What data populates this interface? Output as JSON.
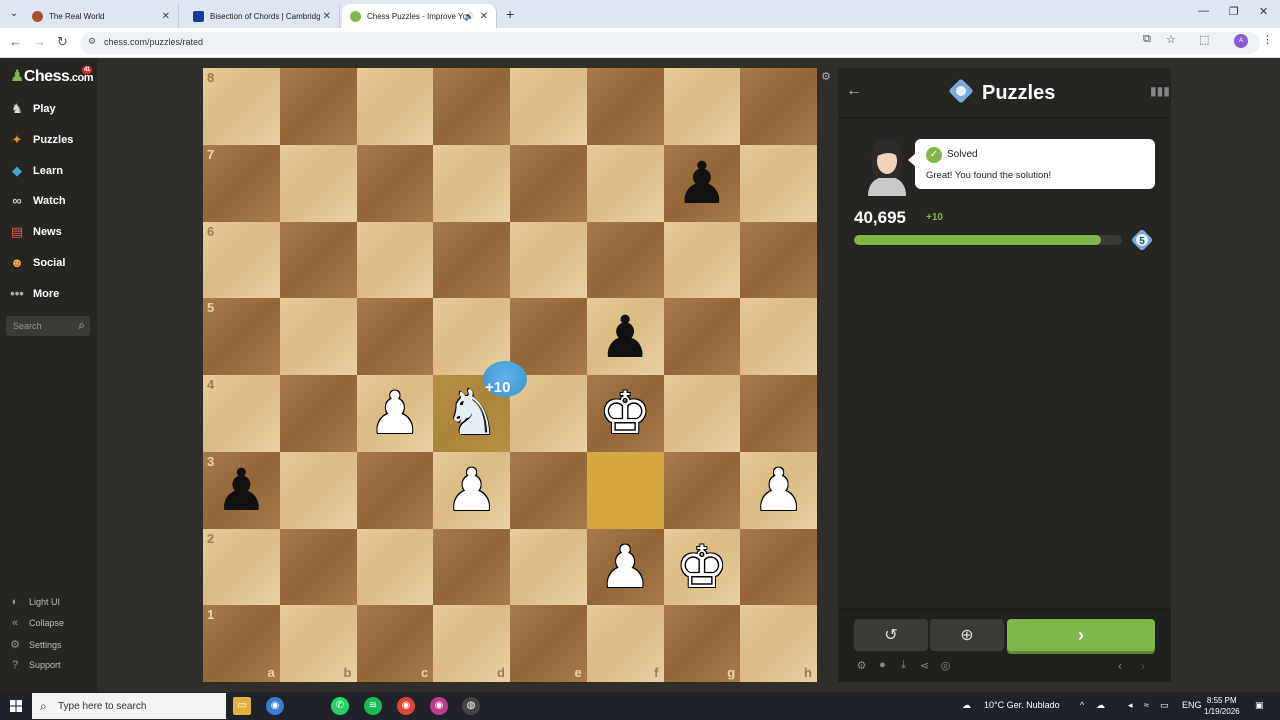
{
  "browser": {
    "tabs": [
      {
        "title": "The Real World",
        "favicon_color": "#a0522d",
        "active": false
      },
      {
        "title": "Bisection of Chords | Cambridge",
        "favicon_color": "#1a3a9c",
        "active": false
      },
      {
        "title": "Chess Puzzles - Improve Yo",
        "favicon_color": "#81b64c",
        "active": true
      }
    ],
    "url": "chess.com/puzzles/rated"
  },
  "sidebar": {
    "logo": "Chess",
    "logo_suffix": ".com",
    "notif_badge": "41",
    "items": [
      {
        "label": "Play",
        "icon": "play-board-icon"
      },
      {
        "label": "Puzzles",
        "icon": "puzzle-piece-icon"
      },
      {
        "label": "Learn",
        "icon": "learn-cap-icon"
      },
      {
        "label": "Watch",
        "icon": "binoculars-icon"
      },
      {
        "label": "News",
        "icon": "newspaper-icon"
      },
      {
        "label": "Social",
        "icon": "people-icon"
      },
      {
        "label": "More",
        "icon": "more-dots-icon"
      }
    ],
    "search_placeholder": "Search",
    "footer": [
      {
        "label": "Light UI",
        "icon": "contrast-icon"
      },
      {
        "label": "Collapse",
        "icon": "collapse-icon"
      },
      {
        "label": "Settings",
        "icon": "gear-icon"
      },
      {
        "label": "Support",
        "icon": "help-icon"
      }
    ]
  },
  "board": {
    "ranks": [
      "8",
      "7",
      "6",
      "5",
      "4",
      "3",
      "2",
      "1"
    ],
    "files": [
      "a",
      "b",
      "c",
      "d",
      "e",
      "f",
      "g",
      "h"
    ],
    "pieces": {
      "g7": {
        "glyph": "♟",
        "color": "b"
      },
      "f5": {
        "glyph": "♟",
        "color": "b"
      },
      "c4": {
        "glyph": "♟",
        "color": "w"
      },
      "d4": {
        "glyph": "♞",
        "color": "wn"
      },
      "f4": {
        "glyph": "♚",
        "color": "w"
      },
      "a3": {
        "glyph": "♟",
        "color": "b"
      },
      "d3": {
        "glyph": "♟",
        "color": "w"
      },
      "h3": {
        "glyph": "♟",
        "color": "w"
      },
      "f2": {
        "glyph": "♟",
        "color": "w"
      },
      "g2": {
        "glyph": "♚",
        "color": "w"
      }
    },
    "highlights": [
      "f3"
    ],
    "soft_highlights": [
      "d4"
    ],
    "bonus_label": "+10"
  },
  "panel": {
    "title": "Puzzles",
    "bubble_status": "Solved",
    "bubble_message": "Great! You found the solution!",
    "rating": "40,695",
    "rating_delta": "+10",
    "progress": 0.92,
    "level": "5",
    "next_label": "›"
  },
  "taskbar": {
    "search_placeholder": "Type here to search",
    "weather": "10°C  Ger. Nublado",
    "lang": "ENG",
    "time": "8:55 PM",
    "date": "1/19/2026"
  }
}
